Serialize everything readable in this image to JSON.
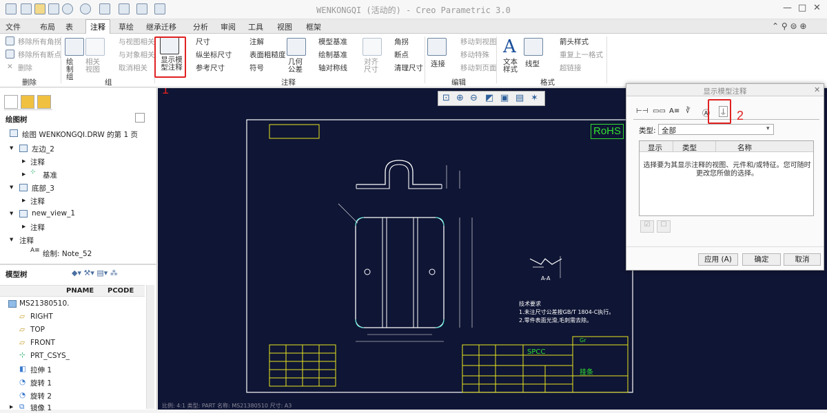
{
  "window": {
    "title": "WENKONGQI (活动的) - Creo Parametric 3.0"
  },
  "tabs": [
    "文件",
    "布局",
    "表",
    "注释",
    "草绘",
    "继承迁移",
    "分析",
    "审阅",
    "工具",
    "视图",
    "框架"
  ],
  "active_tab": "注释",
  "ribbon": {
    "delete_group": {
      "items": [
        "移除所有角拐",
        "移除所有断点",
        "删除"
      ],
      "label": "删除"
    },
    "group_group": {
      "items": [
        "绘制组",
        "相关视图",
        "与视图相关",
        "与对象相关",
        "取消相关"
      ],
      "label": "组"
    },
    "annotation_group": {
      "show_model_annotations": "显示模型注释",
      "items": [
        "尺寸",
        "纵坐标尺寸",
        "参考尺寸",
        "注解",
        "表面粗糙度",
        "符号",
        "几何公差",
        "模型基准",
        "绘制基准",
        "轴对称线",
        "对齐尺寸",
        "角拐",
        "断点",
        "清理尺寸"
      ],
      "label": "注释"
    },
    "edit_group": {
      "items": [
        "连接",
        "移动到视图",
        "移动特殊",
        "移动到页面"
      ],
      "label": "编辑"
    },
    "format_group": {
      "items": [
        "文本样式",
        "线型",
        "箭头样式",
        "重复上一格式",
        "超链接"
      ],
      "label": "格式"
    }
  },
  "drawing_tree": {
    "header": "绘图树",
    "items": [
      "绘图 WENKONGQI.DRW 的第 1 页",
      "左边_2",
      "注释",
      "基准",
      "底部_3",
      "注释",
      "new_view_1",
      "注释",
      "注释",
      "绘制: Note_52"
    ]
  },
  "model_tree": {
    "header": "模型树",
    "columns": [
      "PNAME",
      "PCODE"
    ],
    "items": [
      "MS21380510.",
      "RIGHT",
      "TOP",
      "FRONT",
      "PRT_CSYS_",
      "拉伸 1",
      "旋转 1",
      "旋转 2",
      "镜像 1"
    ]
  },
  "dialog": {
    "title": "显示模型注释",
    "type_label": "类型:",
    "type_value": "全部",
    "columns": [
      "显示",
      "类型",
      "名称"
    ],
    "message": "选择要为其显示注释的视图、元件和/或特征。您可随时更改您所做的选择。",
    "buttons": {
      "apply": "应用 (A)",
      "ok": "确定",
      "cancel": "取消"
    }
  },
  "drawing": {
    "rohs": "RoHS",
    "tech_title": "技术要求",
    "tech_lines": [
      "1.未注尺寸公差按GB/T 1804-C执行。",
      "2.零件表面光滑,毛刺需去除。"
    ],
    "material": "SPCC",
    "status": "比例: 4:1   类型: PART   名称: MS21380510   尺寸: A3",
    "section": "A-A",
    "tb_name": "挂条",
    "gr": "Gr"
  },
  "markers": [
    "1",
    "2"
  ],
  "colors": {
    "canvas": "#0f1534",
    "lines": "#ffffff",
    "frame_yellow": "#e8e820",
    "title_green": "#30e030",
    "red": "#e02020"
  }
}
